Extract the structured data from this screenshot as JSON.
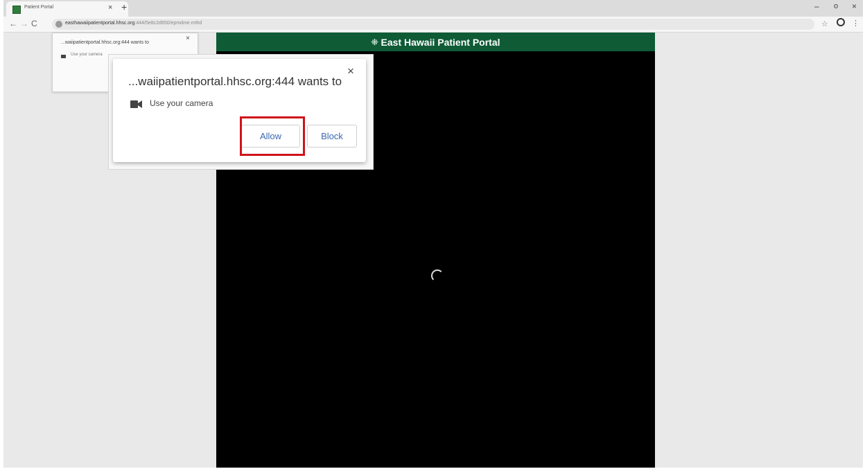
{
  "browser": {
    "tab_title": "Patient Portal",
    "tab_close": "×",
    "new_tab": "+",
    "window_controls": {
      "minimize": "–",
      "maximize": "o",
      "close": "×"
    },
    "nav": {
      "back": "←",
      "forward": "→",
      "reload": "C"
    },
    "url_host": "easthawaiipatientportal.hhsc.org",
    "url_rest": ":444/5e8c2d650/epmdme.mthd",
    "star": "☆",
    "menu": "⋮"
  },
  "portal": {
    "logo_glyph": "⁜",
    "title": "East Hawaii Patient Portal"
  },
  "mini_prompt": {
    "title": "...waiipatientportal.hhsc.org:444 wants to",
    "item": "Use your camera",
    "close": "×"
  },
  "prompt": {
    "title": "...waiipatientportal.hhsc.org:444 wants to",
    "permission": "Use your camera",
    "allow": "Allow",
    "block": "Block",
    "close": "×"
  },
  "colors": {
    "header_green": "#0e5b36",
    "button_text": "#3a67b1",
    "highlight_red": "#d0121b"
  }
}
